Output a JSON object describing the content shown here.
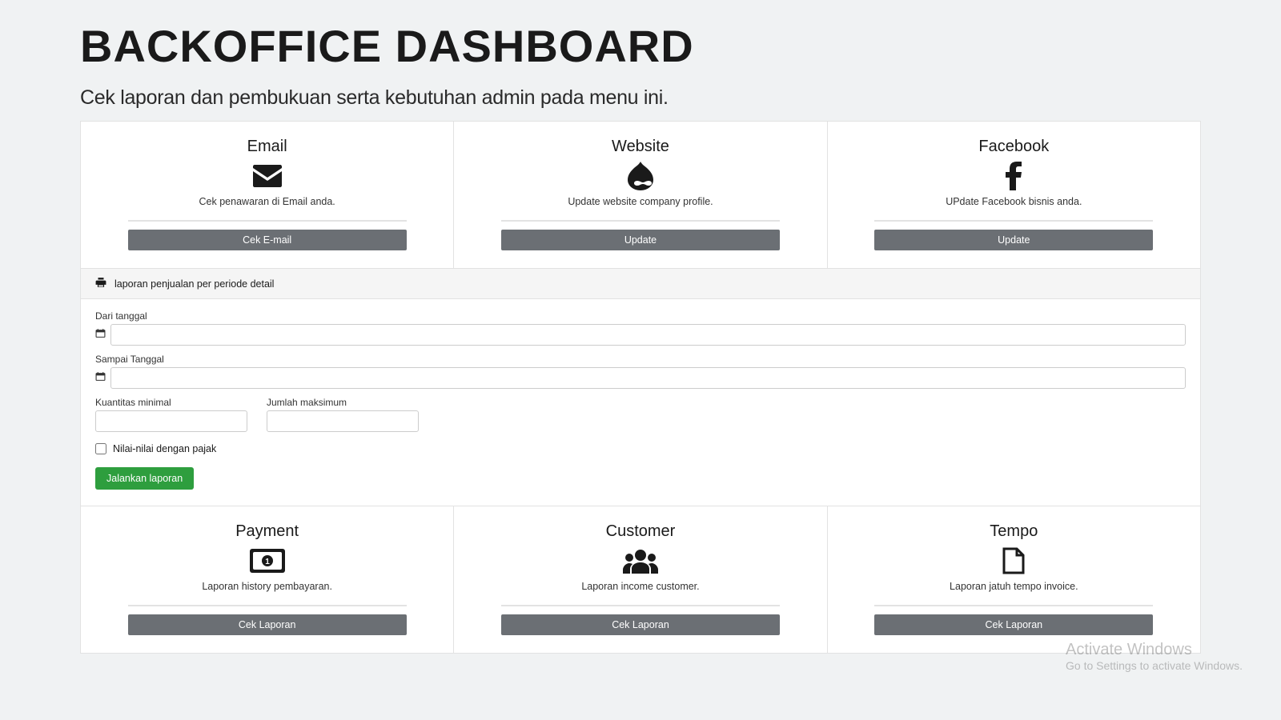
{
  "header": {
    "title": "BACKOFFICE DASHBOARD",
    "subtitle": "Cek laporan dan pembukuan serta kebutuhan admin pada menu ini."
  },
  "top_cards": [
    {
      "title": "Email",
      "desc": "Cek penawaran di Email anda.",
      "button": "Cek E-mail",
      "icon": "envelope"
    },
    {
      "title": "Website",
      "desc": "Update website company profile.",
      "button": "Update",
      "icon": "drupal"
    },
    {
      "title": "Facebook",
      "desc": "UPdate Facebook bisnis anda.",
      "button": "Update",
      "icon": "facebook"
    }
  ],
  "report": {
    "icon": "print",
    "title": "laporan penjualan per periode detail",
    "from_label": "Dari tanggal",
    "to_label": "Sampai Tanggal",
    "from_value": "",
    "to_value": "",
    "qty_min_label": "Kuantitas minimal",
    "qty_min_value": "",
    "qty_max_label": "Jumlah maksimum",
    "qty_max_value": "",
    "tax_checkbox": "Nilai-nilai dengan pajak",
    "run_button": "Jalankan laporan"
  },
  "bottom_cards": [
    {
      "title": "Payment",
      "desc": "Laporan history pembayaran.",
      "button": "Cek Laporan",
      "icon": "money"
    },
    {
      "title": "Customer",
      "desc": "Laporan income customer.",
      "button": "Cek Laporan",
      "icon": "users"
    },
    {
      "title": "Tempo",
      "desc": "Laporan jatuh tempo invoice.",
      "button": "Cek Laporan",
      "icon": "file"
    }
  ],
  "watermark": {
    "line1": "Activate Windows",
    "line2": "Go to Settings to activate Windows."
  }
}
